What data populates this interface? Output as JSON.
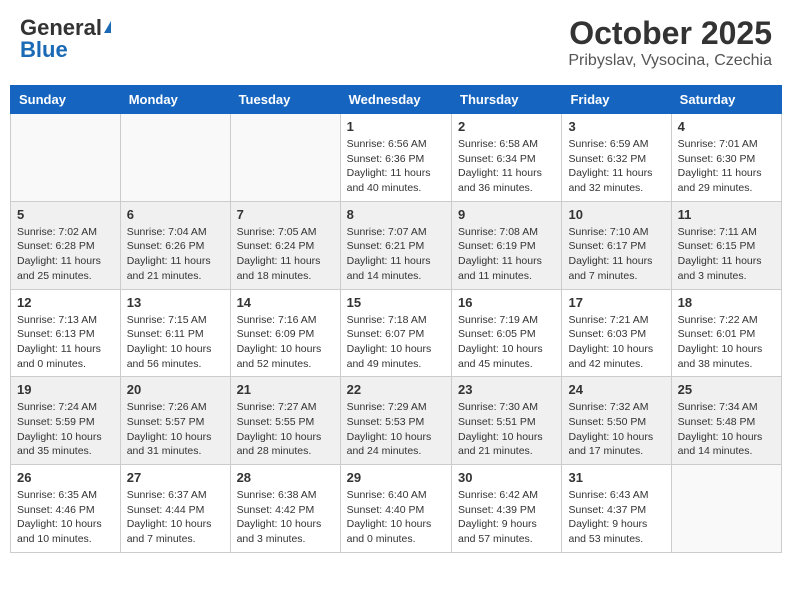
{
  "header": {
    "logo_general": "General",
    "logo_blue": "Blue",
    "month_title": "October 2025",
    "location": "Pribyslav, Vysocina, Czechia"
  },
  "columns": [
    "Sunday",
    "Monday",
    "Tuesday",
    "Wednesday",
    "Thursday",
    "Friday",
    "Saturday"
  ],
  "weeks": [
    {
      "shaded": false,
      "days": [
        {
          "number": "",
          "info": ""
        },
        {
          "number": "",
          "info": ""
        },
        {
          "number": "",
          "info": ""
        },
        {
          "number": "1",
          "info": "Sunrise: 6:56 AM\nSunset: 6:36 PM\nDaylight: 11 hours\nand 40 minutes."
        },
        {
          "number": "2",
          "info": "Sunrise: 6:58 AM\nSunset: 6:34 PM\nDaylight: 11 hours\nand 36 minutes."
        },
        {
          "number": "3",
          "info": "Sunrise: 6:59 AM\nSunset: 6:32 PM\nDaylight: 11 hours\nand 32 minutes."
        },
        {
          "number": "4",
          "info": "Sunrise: 7:01 AM\nSunset: 6:30 PM\nDaylight: 11 hours\nand 29 minutes."
        }
      ]
    },
    {
      "shaded": true,
      "days": [
        {
          "number": "5",
          "info": "Sunrise: 7:02 AM\nSunset: 6:28 PM\nDaylight: 11 hours\nand 25 minutes."
        },
        {
          "number": "6",
          "info": "Sunrise: 7:04 AM\nSunset: 6:26 PM\nDaylight: 11 hours\nand 21 minutes."
        },
        {
          "number": "7",
          "info": "Sunrise: 7:05 AM\nSunset: 6:24 PM\nDaylight: 11 hours\nand 18 minutes."
        },
        {
          "number": "8",
          "info": "Sunrise: 7:07 AM\nSunset: 6:21 PM\nDaylight: 11 hours\nand 14 minutes."
        },
        {
          "number": "9",
          "info": "Sunrise: 7:08 AM\nSunset: 6:19 PM\nDaylight: 11 hours\nand 11 minutes."
        },
        {
          "number": "10",
          "info": "Sunrise: 7:10 AM\nSunset: 6:17 PM\nDaylight: 11 hours\nand 7 minutes."
        },
        {
          "number": "11",
          "info": "Sunrise: 7:11 AM\nSunset: 6:15 PM\nDaylight: 11 hours\nand 3 minutes."
        }
      ]
    },
    {
      "shaded": false,
      "days": [
        {
          "number": "12",
          "info": "Sunrise: 7:13 AM\nSunset: 6:13 PM\nDaylight: 11 hours\nand 0 minutes."
        },
        {
          "number": "13",
          "info": "Sunrise: 7:15 AM\nSunset: 6:11 PM\nDaylight: 10 hours\nand 56 minutes."
        },
        {
          "number": "14",
          "info": "Sunrise: 7:16 AM\nSunset: 6:09 PM\nDaylight: 10 hours\nand 52 minutes."
        },
        {
          "number": "15",
          "info": "Sunrise: 7:18 AM\nSunset: 6:07 PM\nDaylight: 10 hours\nand 49 minutes."
        },
        {
          "number": "16",
          "info": "Sunrise: 7:19 AM\nSunset: 6:05 PM\nDaylight: 10 hours\nand 45 minutes."
        },
        {
          "number": "17",
          "info": "Sunrise: 7:21 AM\nSunset: 6:03 PM\nDaylight: 10 hours\nand 42 minutes."
        },
        {
          "number": "18",
          "info": "Sunrise: 7:22 AM\nSunset: 6:01 PM\nDaylight: 10 hours\nand 38 minutes."
        }
      ]
    },
    {
      "shaded": true,
      "days": [
        {
          "number": "19",
          "info": "Sunrise: 7:24 AM\nSunset: 5:59 PM\nDaylight: 10 hours\nand 35 minutes."
        },
        {
          "number": "20",
          "info": "Sunrise: 7:26 AM\nSunset: 5:57 PM\nDaylight: 10 hours\nand 31 minutes."
        },
        {
          "number": "21",
          "info": "Sunrise: 7:27 AM\nSunset: 5:55 PM\nDaylight: 10 hours\nand 28 minutes."
        },
        {
          "number": "22",
          "info": "Sunrise: 7:29 AM\nSunset: 5:53 PM\nDaylight: 10 hours\nand 24 minutes."
        },
        {
          "number": "23",
          "info": "Sunrise: 7:30 AM\nSunset: 5:51 PM\nDaylight: 10 hours\nand 21 minutes."
        },
        {
          "number": "24",
          "info": "Sunrise: 7:32 AM\nSunset: 5:50 PM\nDaylight: 10 hours\nand 17 minutes."
        },
        {
          "number": "25",
          "info": "Sunrise: 7:34 AM\nSunset: 5:48 PM\nDaylight: 10 hours\nand 14 minutes."
        }
      ]
    },
    {
      "shaded": false,
      "days": [
        {
          "number": "26",
          "info": "Sunrise: 6:35 AM\nSunset: 4:46 PM\nDaylight: 10 hours\nand 10 minutes."
        },
        {
          "number": "27",
          "info": "Sunrise: 6:37 AM\nSunset: 4:44 PM\nDaylight: 10 hours\nand 7 minutes."
        },
        {
          "number": "28",
          "info": "Sunrise: 6:38 AM\nSunset: 4:42 PM\nDaylight: 10 hours\nand 3 minutes."
        },
        {
          "number": "29",
          "info": "Sunrise: 6:40 AM\nSunset: 4:40 PM\nDaylight: 10 hours\nand 0 minutes."
        },
        {
          "number": "30",
          "info": "Sunrise: 6:42 AM\nSunset: 4:39 PM\nDaylight: 9 hours\nand 57 minutes."
        },
        {
          "number": "31",
          "info": "Sunrise: 6:43 AM\nSunset: 4:37 PM\nDaylight: 9 hours\nand 53 minutes."
        },
        {
          "number": "",
          "info": ""
        }
      ]
    }
  ]
}
